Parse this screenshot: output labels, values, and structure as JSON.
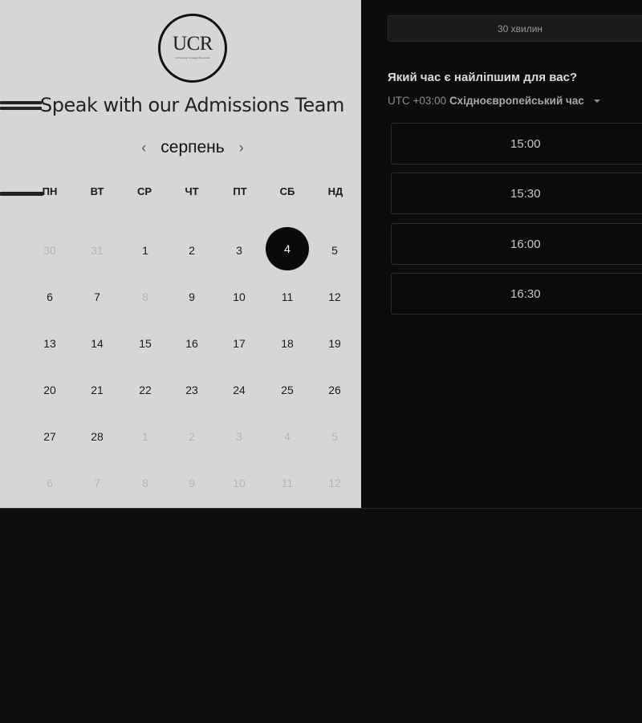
{
  "logo": {
    "text": "UCR",
    "subtitle": "University College Riverside"
  },
  "title": "Speak with our Admissions Team",
  "calendar": {
    "month": "серпень",
    "prev_arrow": "‹",
    "next_arrow": "›",
    "weekdays": [
      "ПН",
      "ВТ",
      "СР",
      "ЧТ",
      "ПТ",
      "СБ",
      "НД"
    ],
    "weeks": [
      [
        "30",
        "31",
        "1",
        "2",
        "3",
        "4",
        "5"
      ],
      [
        "6",
        "7",
        "8",
        "9",
        "10",
        "11",
        "12"
      ],
      [
        "13",
        "14",
        "15",
        "16",
        "17",
        "18",
        "19"
      ],
      [
        "20",
        "21",
        "22",
        "23",
        "24",
        "25",
        "26"
      ],
      [
        "27",
        "28",
        "1",
        "2",
        "3",
        "4",
        "5"
      ],
      [
        "6",
        "7",
        "8",
        "9",
        "10",
        "11",
        "12"
      ]
    ],
    "selected_day": "4"
  },
  "duration": {
    "label": "30 хвилин"
  },
  "time_question": "Який час є найліпшим для вас?",
  "timezone": {
    "offset": "UTC +03:00",
    "name": "Східноєвропейський час"
  },
  "slots": [
    "15:00",
    "15:30",
    "16:00",
    "16:30"
  ],
  "colors": {
    "selected_day_bg": "#0a0a0a",
    "left_panel_bg": "#d6d6d6",
    "right_panel_bg": "#0c0c0c"
  }
}
